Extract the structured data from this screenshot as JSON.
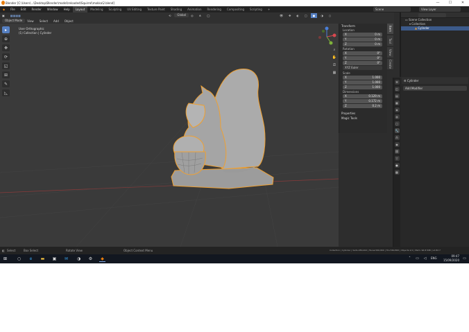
{
  "window": {
    "title": "Blender [C:\\Users\\...\\Desktop\\Blender\\model\\reloaded\\Squirrel\\mokka\\2.blend]",
    "minimize": "—",
    "maximize": "☐",
    "close": "✕"
  },
  "menu": {
    "items": [
      "File",
      "Edit",
      "Render",
      "Window",
      "Help"
    ],
    "workspaces": [
      "Layout",
      "Modeling",
      "Sculpting",
      "UV Editing",
      "Texture Paint",
      "Shading",
      "Animation",
      "Rendering",
      "Compositing",
      "Scripting"
    ],
    "active_workspace": "Layout",
    "add_tab": "+",
    "scene": "Scene",
    "view_layer": "View Layer"
  },
  "viewport_header": {
    "mode": "Object Mode",
    "view": "View",
    "select": "Select",
    "add": "Add",
    "object": "Object",
    "transform": "Global",
    "options": "Options"
  },
  "viewport": {
    "view_name": "User Orthographic",
    "collection_info": "(1) Collection | Cylinder"
  },
  "tools": [
    "select-box",
    "cursor",
    "move",
    "rotate",
    "scale",
    "transform",
    "annotate",
    "measure"
  ],
  "n_panel": {
    "header": "Transform",
    "location_label": "Location",
    "location": [
      {
        "axis": "X",
        "value": "0 m"
      },
      {
        "axis": "Y",
        "value": "0 m"
      },
      {
        "axis": "Z",
        "value": "0 m"
      }
    ],
    "rotation_label": "Rotation",
    "rotation": [
      {
        "axis": "X",
        "value": "0°"
      },
      {
        "axis": "Y",
        "value": "0°"
      },
      {
        "axis": "Z",
        "value": "0°"
      }
    ],
    "rotation_mode": "XYZ Euler",
    "scale_label": "Scale",
    "scale": [
      {
        "axis": "X",
        "value": "1.000"
      },
      {
        "axis": "Y",
        "value": "1.000"
      },
      {
        "axis": "Z",
        "value": "1.000"
      }
    ],
    "dimensions_label": "Dimensions",
    "dimensions": [
      {
        "axis": "X",
        "value": "0.129 m"
      },
      {
        "axis": "Y",
        "value": "0.172 m"
      },
      {
        "axis": "Z",
        "value": "0.2 m"
      }
    ],
    "properties": "Properties",
    "magic_tools": "Magic Tools",
    "tabs": [
      "Item",
      "Tool",
      "View",
      "Create"
    ]
  },
  "outliner": {
    "root": "Scene Collection",
    "collection": "Collection",
    "object": "Cylinder"
  },
  "properties": {
    "object_name": "Cylinder",
    "add_modifier": "Add Modifier"
  },
  "statusbar": {
    "select": "Select",
    "box_select": "Box Select",
    "rotate_view": "Rotate View",
    "context_menu": "Object Context Menu",
    "stats": "Collection | Cylinder | Verts:280,402 | Faces:560,800 | Tris:560,800 | Objects:1/1 | Mem: 96.8 MiB | v2.82.7"
  },
  "taskbar": {
    "lang": "ENG",
    "time": "09:47",
    "date": "15/09/2020"
  },
  "colors": {
    "accent": "#5680c2",
    "selection_outline": "#f0a030",
    "grid_x_axis": "#8a3a3a",
    "grid_y_axis": "#6a8a2a"
  }
}
